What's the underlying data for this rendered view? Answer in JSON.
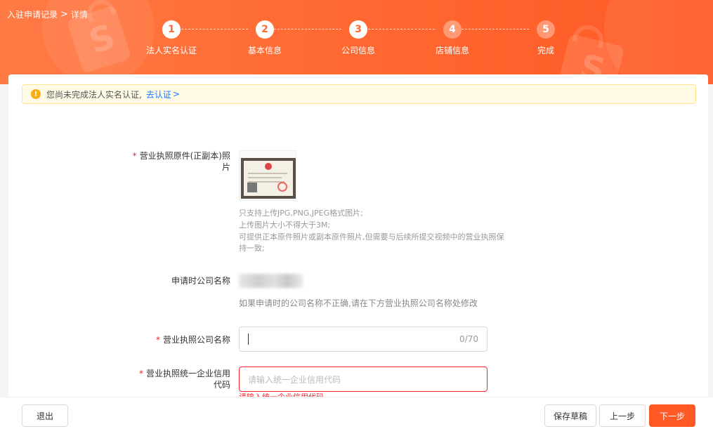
{
  "breadcrumb": {
    "parent": "入驻申请记录",
    "separator": ">",
    "current": "详情"
  },
  "steps": [
    {
      "number": "1",
      "label": "法人实名认证",
      "state": "active"
    },
    {
      "number": "2",
      "label": "基本信息",
      "state": "active"
    },
    {
      "number": "3",
      "label": "公司信息",
      "state": "active"
    },
    {
      "number": "4",
      "label": "店铺信息",
      "state": "pending"
    },
    {
      "number": "5",
      "label": "完成",
      "state": "pending"
    }
  ],
  "notice": {
    "icon": "warning-icon",
    "text": "您尚未完成法人实名认证,",
    "link": "去认证",
    "link_arrow": ">"
  },
  "form": {
    "license_photo": {
      "required_mark": "*",
      "label_line1": "营业执照原件(正副本)照",
      "label_line2": "片",
      "hints": [
        "只支持上传JPG,PNG,JPEG格式图片;",
        "上传图片大小不得大于3M;",
        "可提供正本原件照片或副本原件照片,但需要与后续所提交视频中的营业执照保",
        "持一致;"
      ]
    },
    "applied_company_name": {
      "label": "申请时公司名称",
      "hint": "如果申请时的公司名称不正确,请在下方营业执照公司名称处修改"
    },
    "license_company_name": {
      "required_mark": "*",
      "label": "营业执照公司名称",
      "value": "",
      "counter": "0/70"
    },
    "credit_code": {
      "required_mark": "*",
      "label_line1": "营业执照统一企业信用",
      "label_line2": "代码",
      "placeholder": "请输入统一企业信用代码",
      "error": "请输入统一企业信用代码"
    }
  },
  "footer": {
    "exit": "退出",
    "save_draft": "保存草稿",
    "prev": "上一步",
    "next": "下一步"
  },
  "colors": {
    "brand": "#ff5a26",
    "warning": "#faad14",
    "link": "#1677ff",
    "error": "#f5222d"
  }
}
